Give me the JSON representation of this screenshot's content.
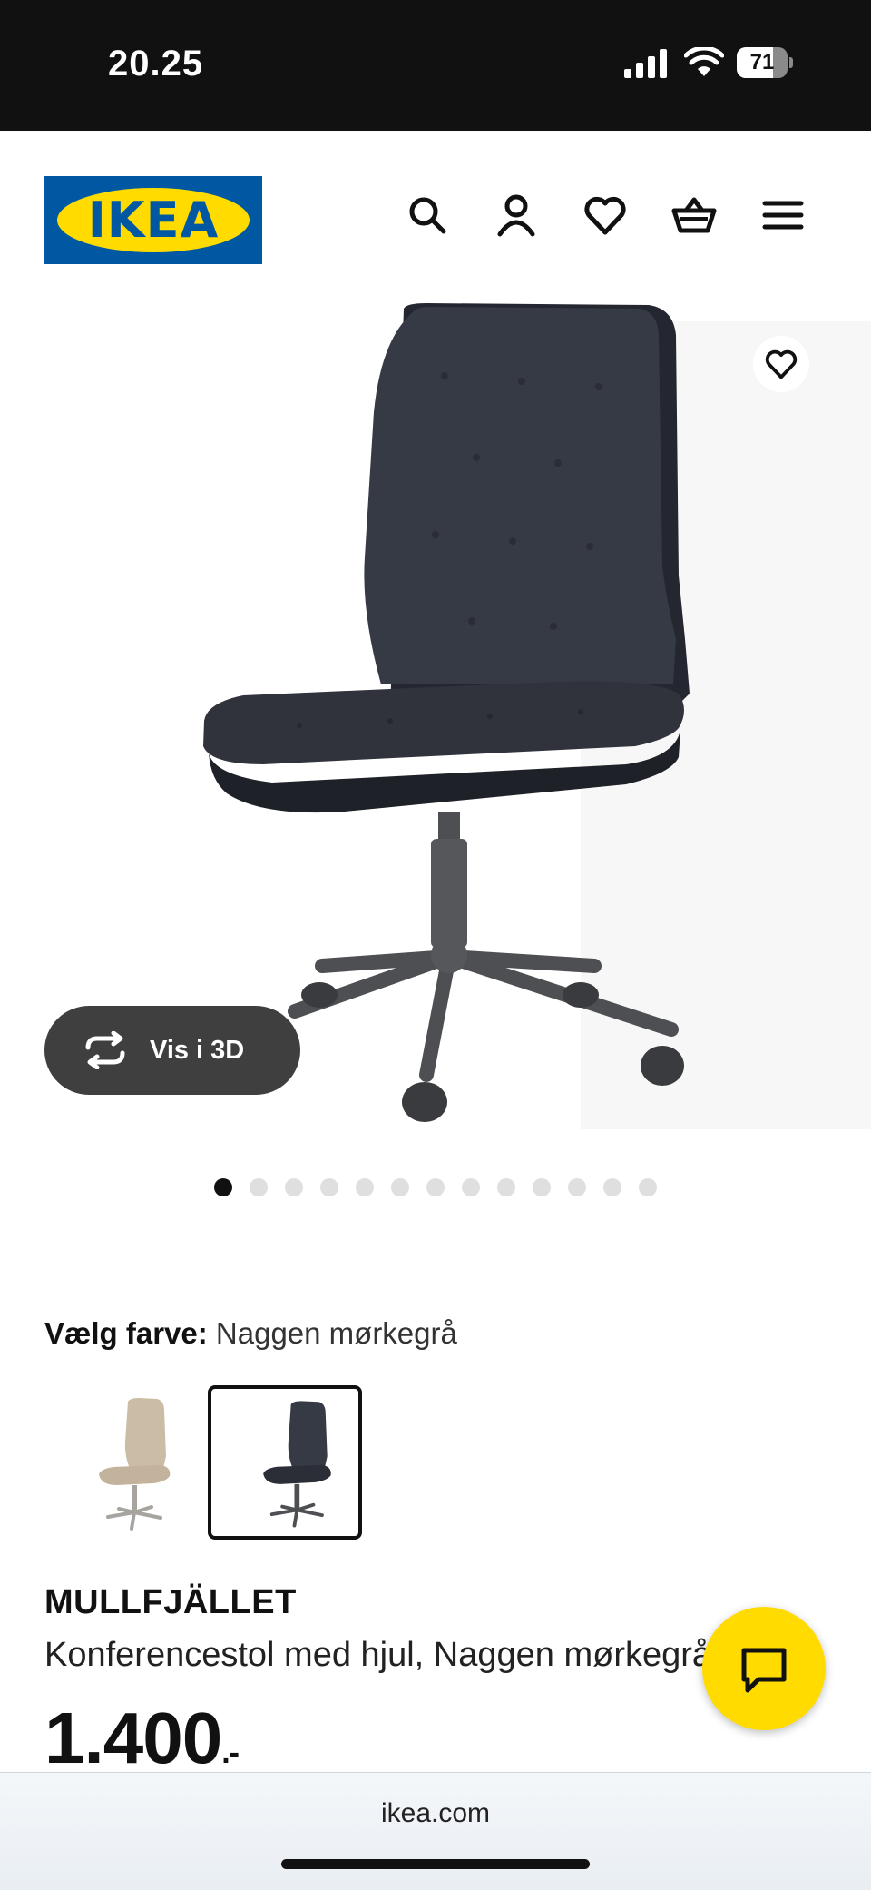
{
  "status_bar": {
    "time": "20.25",
    "battery": "71",
    "battery_level": 0.71
  },
  "header": {
    "logo_text": "IKEA",
    "icons": [
      "search-icon",
      "user-icon",
      "heart-icon",
      "cart-basket-icon",
      "menu-icon"
    ]
  },
  "gallery": {
    "view_3d_label": "Vis i 3D",
    "image_count": 13,
    "active_index": 0
  },
  "colors": {
    "label": "Vælg farve:",
    "selected_value": "Naggen mørkegrå",
    "options": [
      "beige",
      "Naggen mørkegrå"
    ],
    "selected_index": 1
  },
  "product": {
    "name": "MULLFJÄLLET",
    "description": "Konferencestol med hjul, Naggen mørkegrå",
    "price_main": "1.400",
    "price_suffix": ".-"
  },
  "browser": {
    "url": "ikea.com"
  },
  "theme": {
    "brand_blue": "#0058a3",
    "brand_yellow": "#ffdb00"
  }
}
